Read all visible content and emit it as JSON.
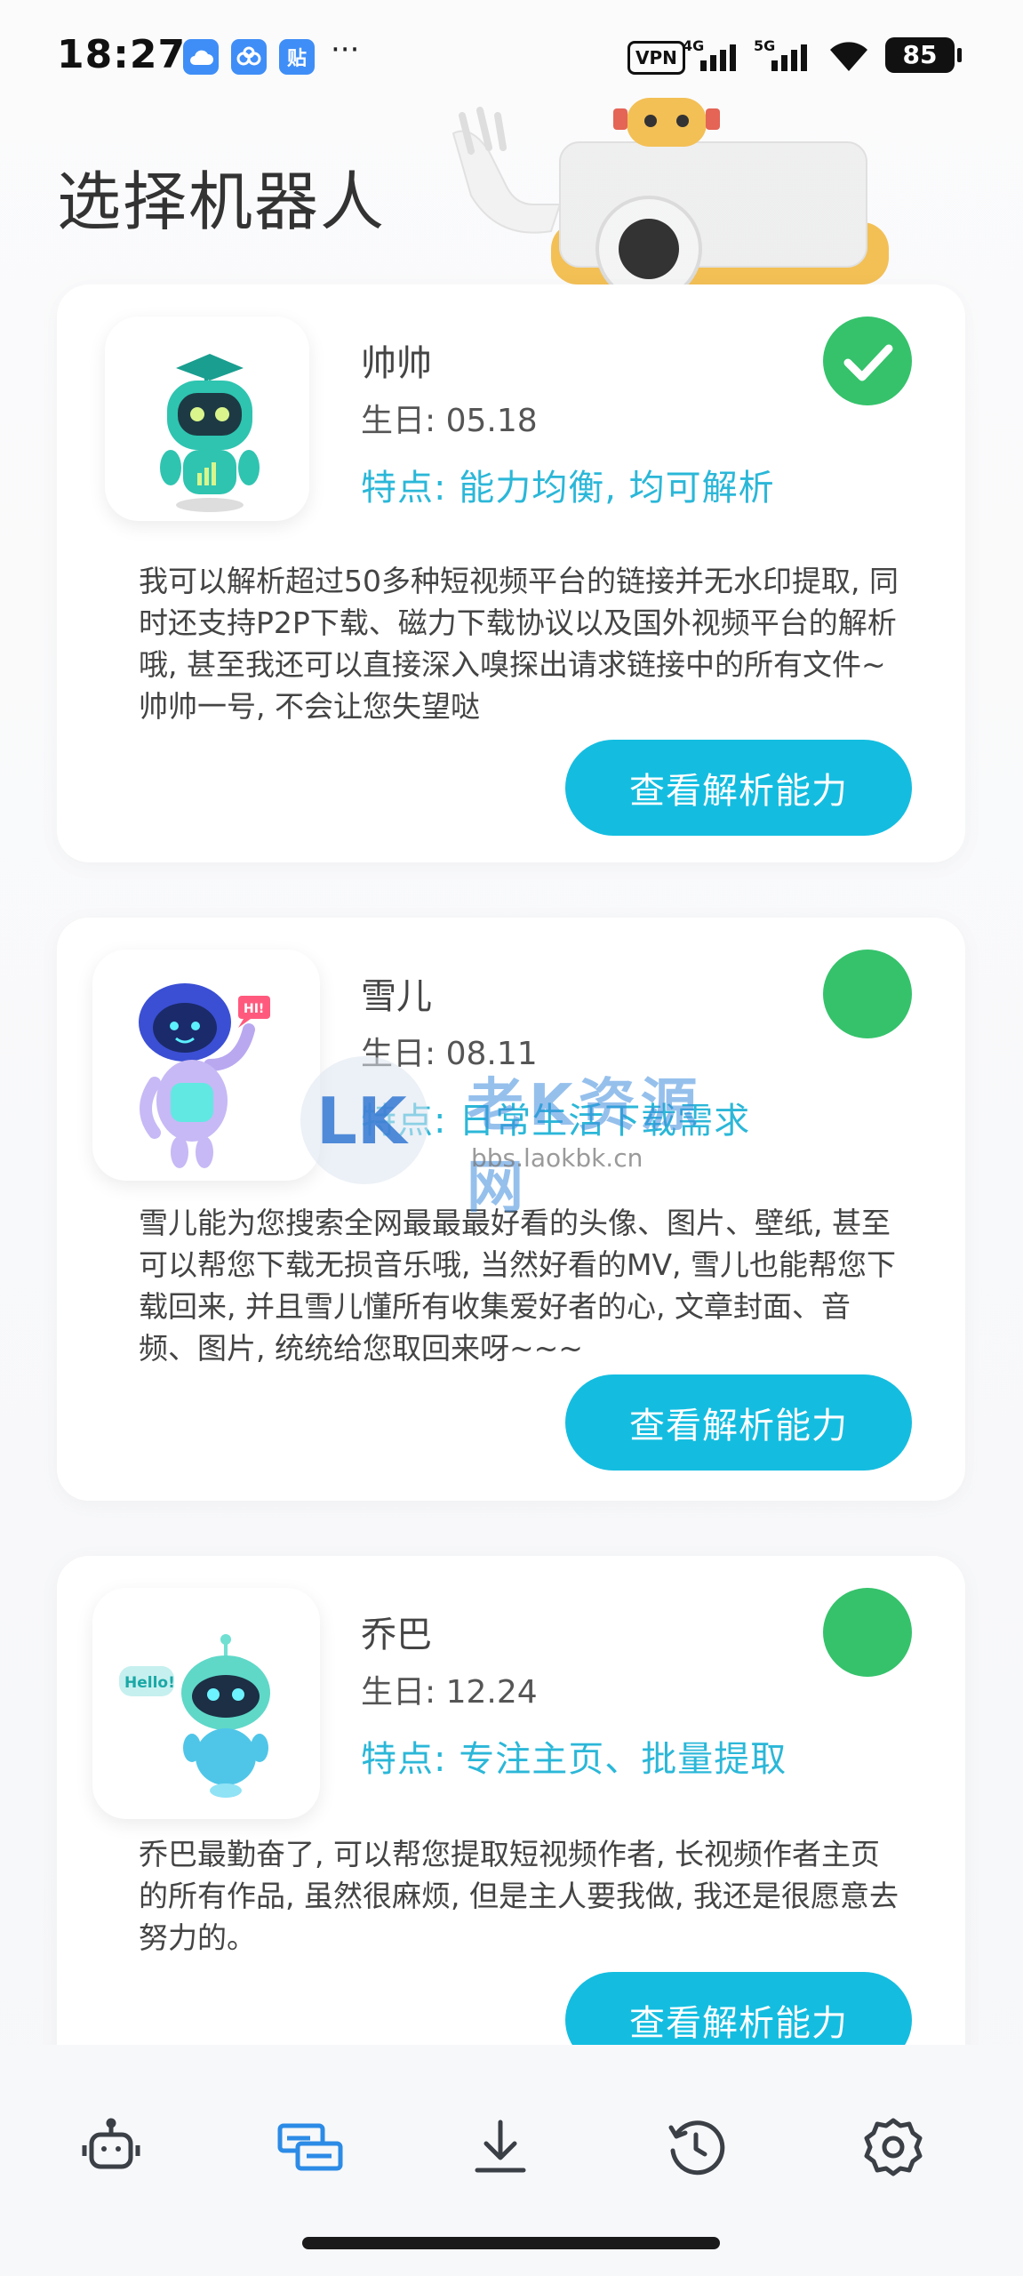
{
  "status_bar": {
    "time": "18:27",
    "dots": "···",
    "apps": [
      {
        "icon": "cloud-app-icon",
        "color": "#3f8ef7",
        "glyph": "☁"
      },
      {
        "icon": "baidu-app-icon",
        "color": "#3f8ef7",
        "glyph": "∞"
      },
      {
        "icon": "tieba-app-icon",
        "color": "#3f8ef7",
        "glyph": "贴"
      }
    ],
    "vpn": "VPN",
    "signal_1": "4G",
    "signal_2": "5G",
    "battery": "85"
  },
  "page_title": "选择机器人",
  "accent_color": "#14bde0",
  "selected_color": "#35c26b",
  "robots": [
    {
      "name": "帅帅",
      "birthday": "生日: 05.18",
      "feature": "特点: 能力均衡, 均可解析",
      "description": "我可以解析超过50多种短视频平台的链接并无水印提取, 同时还支持P2P下载、磁力下载协议以及国外视频平台的解析哦, 甚至我还可以直接深入嗅探出请求链接中的所有文件~帅帅一号, 不会让您失望哒",
      "button": "查看解析能力",
      "selected": true
    },
    {
      "name": "雪儿",
      "birthday": "生日: 08.11",
      "feature": "特点: 日常生活下载需求",
      "description": "雪儿能为您搜索全网最最最好看的头像、图片、壁纸, 甚至可以帮您下载无损音乐哦, 当然好看的MV, 雪儿也能帮您下载回来, 并且雪儿懂所有收集爱好者的心, 文章封面、音频、图片, 统统给您取回来呀~~~",
      "button": "查看解析能力",
      "selected": false,
      "bubble": "HI!"
    },
    {
      "name": "乔巴",
      "birthday": "生日: 12.24",
      "feature": "特点: 专注主页、批量提取",
      "description": "乔巴最勤奋了, 可以帮您提取短视频作者, 长视频作者主页的所有作品, 虽然很麻烦, 但是主人要我做, 我还是很愿意去努力的。",
      "button": "查看解析能力",
      "selected": false,
      "bubble": "Hello!"
    }
  ],
  "watermark": {
    "logo": "LK",
    "text": "老K资源网",
    "url": "bbs.laokbk.cn"
  },
  "bottom_nav": [
    {
      "icon": "robot-icon",
      "active": false
    },
    {
      "icon": "link-parse-icon",
      "active": true
    },
    {
      "icon": "download-icon",
      "active": false
    },
    {
      "icon": "history-icon",
      "active": false
    },
    {
      "icon": "settings-gear-icon",
      "active": false
    }
  ]
}
